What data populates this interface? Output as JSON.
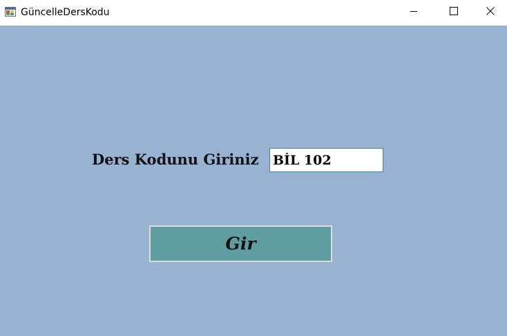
{
  "window": {
    "title": "GüncelleDersKodu",
    "icon": "windows-form-icon",
    "controls": {
      "minimize_icon": "minimize-icon",
      "maximize_icon": "maximize-icon",
      "close_icon": "close-icon"
    }
  },
  "form": {
    "prompt_label": "Ders Kodunu Giriniz",
    "code_input": {
      "value": "BİL 102",
      "placeholder": ""
    },
    "submit_label": "Gir"
  },
  "colors": {
    "client_background": "#98b3d1",
    "button_background": "#5f9ea0",
    "input_border": "#3c7fc4",
    "titlebar_background": "#ffffff"
  }
}
